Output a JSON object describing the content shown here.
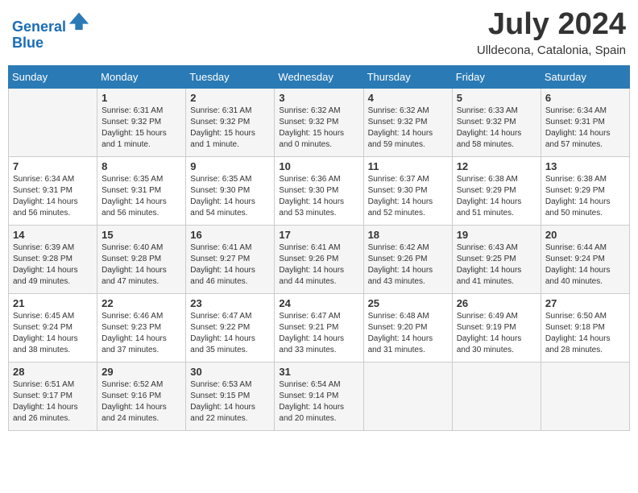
{
  "header": {
    "logo_line1": "General",
    "logo_line2": "Blue",
    "month_title": "July 2024",
    "location": "Ulldecona, Catalonia, Spain"
  },
  "weekdays": [
    "Sunday",
    "Monday",
    "Tuesday",
    "Wednesday",
    "Thursday",
    "Friday",
    "Saturday"
  ],
  "weeks": [
    [
      {
        "day": "",
        "info": ""
      },
      {
        "day": "1",
        "info": "Sunrise: 6:31 AM\nSunset: 9:32 PM\nDaylight: 15 hours\nand 1 minute."
      },
      {
        "day": "2",
        "info": "Sunrise: 6:31 AM\nSunset: 9:32 PM\nDaylight: 15 hours\nand 1 minute."
      },
      {
        "day": "3",
        "info": "Sunrise: 6:32 AM\nSunset: 9:32 PM\nDaylight: 15 hours\nand 0 minutes."
      },
      {
        "day": "4",
        "info": "Sunrise: 6:32 AM\nSunset: 9:32 PM\nDaylight: 14 hours\nand 59 minutes."
      },
      {
        "day": "5",
        "info": "Sunrise: 6:33 AM\nSunset: 9:32 PM\nDaylight: 14 hours\nand 58 minutes."
      },
      {
        "day": "6",
        "info": "Sunrise: 6:34 AM\nSunset: 9:31 PM\nDaylight: 14 hours\nand 57 minutes."
      }
    ],
    [
      {
        "day": "7",
        "info": "Sunrise: 6:34 AM\nSunset: 9:31 PM\nDaylight: 14 hours\nand 56 minutes."
      },
      {
        "day": "8",
        "info": "Sunrise: 6:35 AM\nSunset: 9:31 PM\nDaylight: 14 hours\nand 56 minutes."
      },
      {
        "day": "9",
        "info": "Sunrise: 6:35 AM\nSunset: 9:30 PM\nDaylight: 14 hours\nand 54 minutes."
      },
      {
        "day": "10",
        "info": "Sunrise: 6:36 AM\nSunset: 9:30 PM\nDaylight: 14 hours\nand 53 minutes."
      },
      {
        "day": "11",
        "info": "Sunrise: 6:37 AM\nSunset: 9:30 PM\nDaylight: 14 hours\nand 52 minutes."
      },
      {
        "day": "12",
        "info": "Sunrise: 6:38 AM\nSunset: 9:29 PM\nDaylight: 14 hours\nand 51 minutes."
      },
      {
        "day": "13",
        "info": "Sunrise: 6:38 AM\nSunset: 9:29 PM\nDaylight: 14 hours\nand 50 minutes."
      }
    ],
    [
      {
        "day": "14",
        "info": "Sunrise: 6:39 AM\nSunset: 9:28 PM\nDaylight: 14 hours\nand 49 minutes."
      },
      {
        "day": "15",
        "info": "Sunrise: 6:40 AM\nSunset: 9:28 PM\nDaylight: 14 hours\nand 47 minutes."
      },
      {
        "day": "16",
        "info": "Sunrise: 6:41 AM\nSunset: 9:27 PM\nDaylight: 14 hours\nand 46 minutes."
      },
      {
        "day": "17",
        "info": "Sunrise: 6:41 AM\nSunset: 9:26 PM\nDaylight: 14 hours\nand 44 minutes."
      },
      {
        "day": "18",
        "info": "Sunrise: 6:42 AM\nSunset: 9:26 PM\nDaylight: 14 hours\nand 43 minutes."
      },
      {
        "day": "19",
        "info": "Sunrise: 6:43 AM\nSunset: 9:25 PM\nDaylight: 14 hours\nand 41 minutes."
      },
      {
        "day": "20",
        "info": "Sunrise: 6:44 AM\nSunset: 9:24 PM\nDaylight: 14 hours\nand 40 minutes."
      }
    ],
    [
      {
        "day": "21",
        "info": "Sunrise: 6:45 AM\nSunset: 9:24 PM\nDaylight: 14 hours\nand 38 minutes."
      },
      {
        "day": "22",
        "info": "Sunrise: 6:46 AM\nSunset: 9:23 PM\nDaylight: 14 hours\nand 37 minutes."
      },
      {
        "day": "23",
        "info": "Sunrise: 6:47 AM\nSunset: 9:22 PM\nDaylight: 14 hours\nand 35 minutes."
      },
      {
        "day": "24",
        "info": "Sunrise: 6:47 AM\nSunset: 9:21 PM\nDaylight: 14 hours\nand 33 minutes."
      },
      {
        "day": "25",
        "info": "Sunrise: 6:48 AM\nSunset: 9:20 PM\nDaylight: 14 hours\nand 31 minutes."
      },
      {
        "day": "26",
        "info": "Sunrise: 6:49 AM\nSunset: 9:19 PM\nDaylight: 14 hours\nand 30 minutes."
      },
      {
        "day": "27",
        "info": "Sunrise: 6:50 AM\nSunset: 9:18 PM\nDaylight: 14 hours\nand 28 minutes."
      }
    ],
    [
      {
        "day": "28",
        "info": "Sunrise: 6:51 AM\nSunset: 9:17 PM\nDaylight: 14 hours\nand 26 minutes."
      },
      {
        "day": "29",
        "info": "Sunrise: 6:52 AM\nSunset: 9:16 PM\nDaylight: 14 hours\nand 24 minutes."
      },
      {
        "day": "30",
        "info": "Sunrise: 6:53 AM\nSunset: 9:15 PM\nDaylight: 14 hours\nand 22 minutes."
      },
      {
        "day": "31",
        "info": "Sunrise: 6:54 AM\nSunset: 9:14 PM\nDaylight: 14 hours\nand 20 minutes."
      },
      {
        "day": "",
        "info": ""
      },
      {
        "day": "",
        "info": ""
      },
      {
        "day": "",
        "info": ""
      }
    ]
  ]
}
